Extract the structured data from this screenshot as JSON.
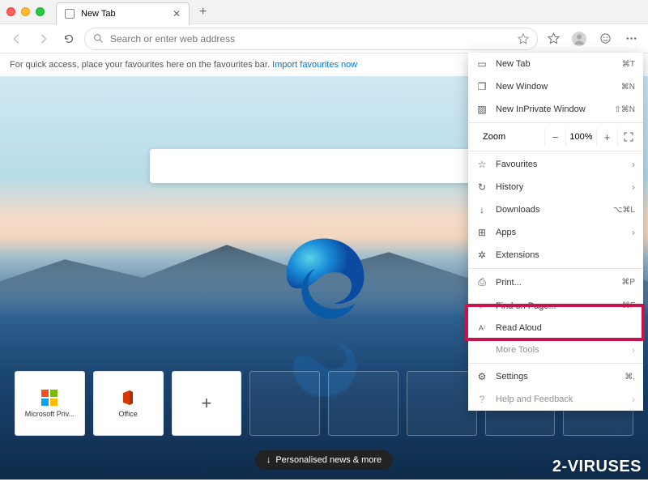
{
  "tab": {
    "title": "New Tab"
  },
  "address": {
    "placeholder": "Search or enter web address"
  },
  "favourites_prompt": {
    "text": "For quick access, place your favourites here on the favourites bar.",
    "link": "Import favourites now"
  },
  "tiles": [
    {
      "label": "Microsoft Priv..."
    },
    {
      "label": "Office"
    }
  ],
  "news_button": "Personalised news & more",
  "watermark": "2-VIRUSES",
  "menu": {
    "new_tab": {
      "label": "New Tab",
      "shortcut": "⌘T"
    },
    "new_window": {
      "label": "New Window",
      "shortcut": "⌘N"
    },
    "new_inprivate": {
      "label": "New InPrivate Window",
      "shortcut": "⇧⌘N"
    },
    "zoom": {
      "label": "Zoom",
      "value": "100%"
    },
    "favourites": {
      "label": "Favourites"
    },
    "history": {
      "label": "History"
    },
    "downloads": {
      "label": "Downloads",
      "shortcut": "⌥⌘L"
    },
    "apps": {
      "label": "Apps"
    },
    "extensions": {
      "label": "Extensions"
    },
    "print": {
      "label": "Print...",
      "shortcut": "⌘P"
    },
    "find": {
      "label": "Find on Page...",
      "shortcut": "⌘F"
    },
    "read_aloud": {
      "label": "Read Aloud"
    },
    "more_tools": {
      "label": "More Tools"
    },
    "settings": {
      "label": "Settings",
      "shortcut": "⌘,"
    },
    "help": {
      "label": "Help and Feedback"
    }
  }
}
